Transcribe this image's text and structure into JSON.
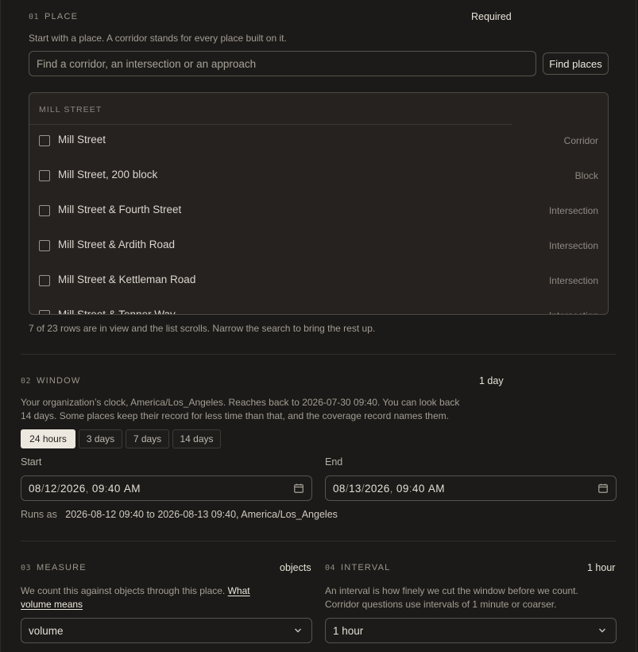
{
  "place": {
    "num": "01",
    "label": "PLACE",
    "badge": "Required",
    "intro": "Start with a place. A corridor stands for every place built on it.",
    "search_placeholder": "Find a corridor, an intersection or an approach",
    "find_button": "Find places",
    "list_heading": "MILL STREET",
    "rows": [
      {
        "label": "Mill Street",
        "kind": "Corridor"
      },
      {
        "label": "Mill Street, 200 block",
        "kind": "Block"
      },
      {
        "label": "Mill Street & Fourth Street",
        "kind": "Intersection"
      },
      {
        "label": "Mill Street & Ardith Road",
        "kind": "Intersection"
      },
      {
        "label": "Mill Street & Kettleman Road",
        "kind": "Intersection"
      },
      {
        "label": "Mill Street & Tenner Way",
        "kind": "Intersection"
      }
    ],
    "scroll_note": "7 of 23 rows are in view and the list scrolls. Narrow the search to bring the rest up."
  },
  "window": {
    "num": "02",
    "label": "WINDOW",
    "value": "1 day",
    "desc_line1": "Your organization’s clock, America/Los_Angeles. Reaches back to 2026-07-30 09:40. You can look back",
    "desc_line2": "14 days. Some places keep their record for less time than that, and the coverage record names them.",
    "presets": [
      "24 hours",
      "3 days",
      "7 days",
      "14 days"
    ],
    "active_preset": "24 hours",
    "start_label": "Start",
    "end_label": "End",
    "start": {
      "mm": "08",
      "dd": "12",
      "yyyy": "2026",
      "hh": "09",
      "min": "40",
      "ampm": "AM"
    },
    "end": {
      "mm": "08",
      "dd": "13",
      "yyyy": "2026",
      "hh": "09",
      "min": "40",
      "ampm": "AM"
    },
    "runs_as_label": "Runs as",
    "runs_as_value": "2026-08-12 09:40 to 2026-08-13 09:40, America/Los_Angeles"
  },
  "measure": {
    "num": "03",
    "label": "MEASURE",
    "value": "objects",
    "desc_text": "We count this against objects through this place. ",
    "link_part1": "What",
    "link_part2": "volume means",
    "selected": "volume"
  },
  "interval": {
    "num": "04",
    "label": "INTERVAL",
    "value": "1 hour",
    "desc_line1": "An interval is how finely we cut the window before we count.",
    "desc_line2": "Corridor questions use intervals of 1 minute or coarser.",
    "selected": "1 hour"
  },
  "colors": {
    "background": "#1c1a18",
    "active_chip": "#ede8df",
    "border": "#57524c"
  }
}
